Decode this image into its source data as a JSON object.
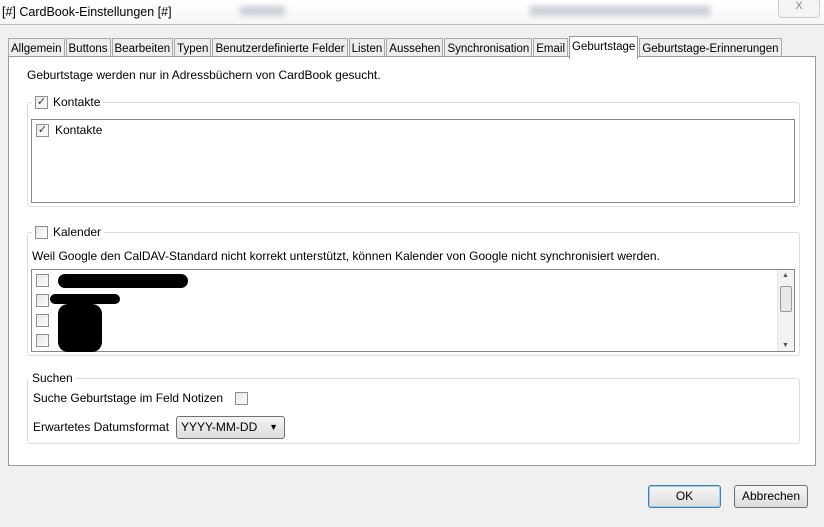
{
  "window": {
    "title": "[#] CardBook-Einstellungen [#]",
    "close_label": "X"
  },
  "tabs": [
    "Allgemein",
    "Buttons",
    "Bearbeiten",
    "Typen",
    "Benutzerdefinierte Felder",
    "Listen",
    "Aussehen",
    "Synchronisation",
    "Email",
    "Geburtstage",
    "Geburtstage-Erinnerungen"
  ],
  "active_tab": "Geburtstage",
  "info": "Geburtstage werden nur in Adressbüchern von CardBook gesucht.",
  "contacts": {
    "label": "Kontakte",
    "checked": true,
    "items": [
      {
        "label": "Kontakte",
        "checked": true
      }
    ]
  },
  "calendars": {
    "label": "Kalender",
    "checked": false,
    "warning": "Weil Google den CalDAV-Standard nicht korrekt unterstützt, können Kalender von Google nicht synchronisiert werden."
  },
  "search": {
    "title": "Suchen",
    "notes_label": "Suche Geburtstage im Feld Notizen",
    "format_label": "Erwartetes Datumsformat",
    "format_value": "YYYY-MM-DD"
  },
  "buttons": {
    "ok": "OK",
    "cancel": "Abbrechen"
  }
}
